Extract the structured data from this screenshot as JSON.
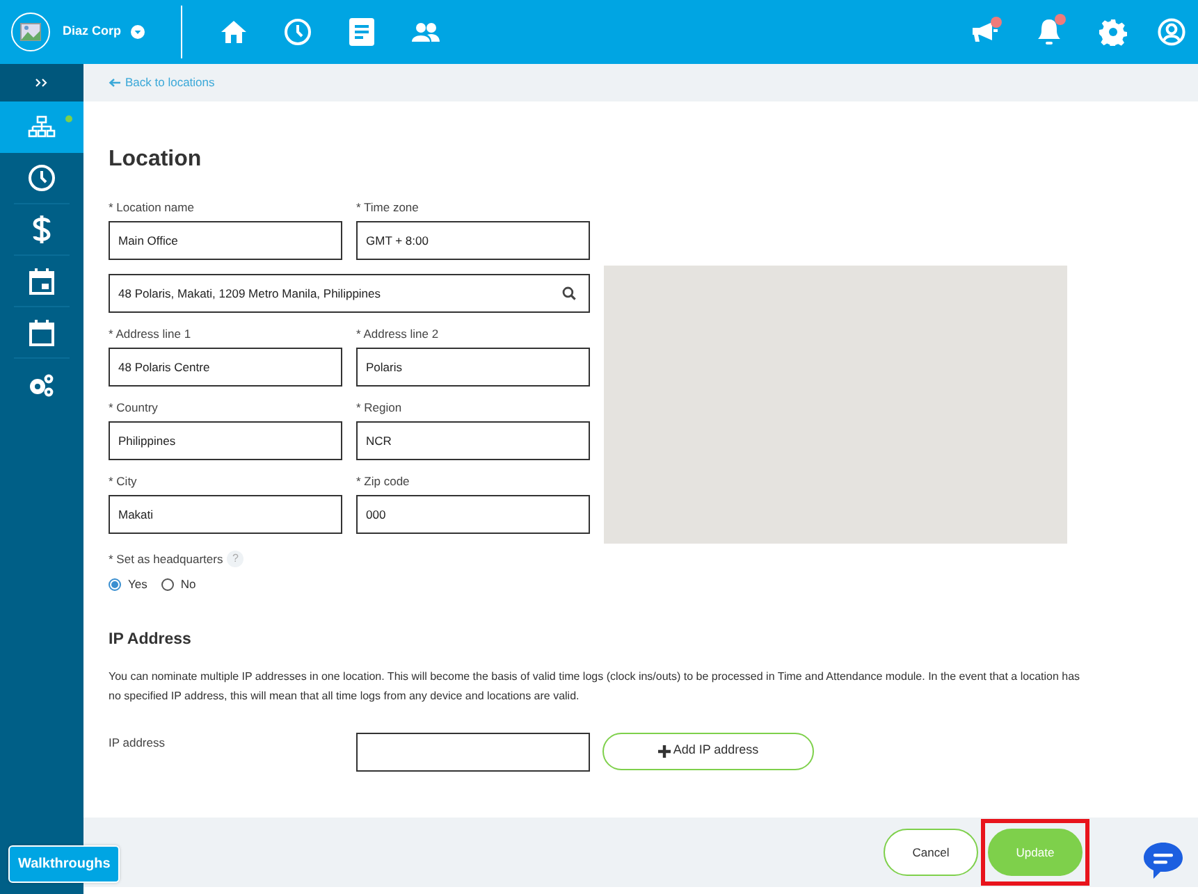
{
  "header": {
    "company": "Diaz Corp",
    "nav": [
      {
        "kind": "home"
      },
      {
        "kind": "clock"
      },
      {
        "kind": "document"
      },
      {
        "kind": "people"
      }
    ],
    "actions": [
      {
        "kind": "megaphone",
        "badge": true
      },
      {
        "kind": "bell",
        "badge": true
      },
      {
        "kind": "gear",
        "badge": false
      },
      {
        "kind": "user",
        "badge": false
      }
    ]
  },
  "sidebar": {
    "items": [
      {
        "kind": "org",
        "selected": true,
        "indicator": true
      },
      {
        "kind": "clock",
        "selected": false,
        "indicator": false
      },
      {
        "kind": "dollar",
        "selected": false,
        "indicator": false
      },
      {
        "kind": "calendar-day",
        "selected": false,
        "indicator": false
      },
      {
        "kind": "calendar",
        "selected": false,
        "indicator": false
      },
      {
        "kind": "gears",
        "selected": false,
        "indicator": false
      }
    ]
  },
  "back_link": "Back to locations",
  "form": {
    "title": "Location",
    "fields": [
      {
        "kind": "text",
        "label": "* Location name",
        "value": "Main Office"
      },
      {
        "kind": "text",
        "label": "* Time zone",
        "value": "GMT + 8:00"
      },
      {
        "kind": "search",
        "value": "48 Polaris, Makati, 1209 Metro Manila, Philippines"
      },
      {
        "kind": "text",
        "label": "* Address line 1",
        "value": "48 Polaris Centre"
      },
      {
        "kind": "text",
        "label": "* Address line 2",
        "value": "Polaris"
      },
      {
        "kind": "text",
        "label": "* Country",
        "value": "Philippines"
      },
      {
        "kind": "text",
        "label": "* Region",
        "value": "NCR"
      },
      {
        "kind": "text",
        "label": "* City",
        "value": "Makati"
      },
      {
        "kind": "text",
        "label": "* Zip code",
        "value": "000"
      }
    ],
    "headquarters": {
      "label": "* Set as headquarters",
      "help": "?",
      "options": [
        {
          "label": "Yes",
          "selected": true
        },
        {
          "label": "No",
          "selected": false
        }
      ]
    }
  },
  "ip_section": {
    "title": "IP Address",
    "description": "You can nominate multiple IP addresses in one location. This will become the basis of valid time logs (clock ins/outs) to be processed in Time and Attendance module. In the event that a location has no specified IP address, this will mean that all time logs from any device and locations are valid.",
    "field_label": "IP address",
    "add_button": "Add IP address"
  },
  "footer": {
    "buttons": [
      {
        "label": "Cancel",
        "kind": "secondary",
        "highlighted": false
      },
      {
        "label": "Update",
        "kind": "primary",
        "highlighted": true
      }
    ]
  },
  "walkthroughs": "Walkthroughs"
}
